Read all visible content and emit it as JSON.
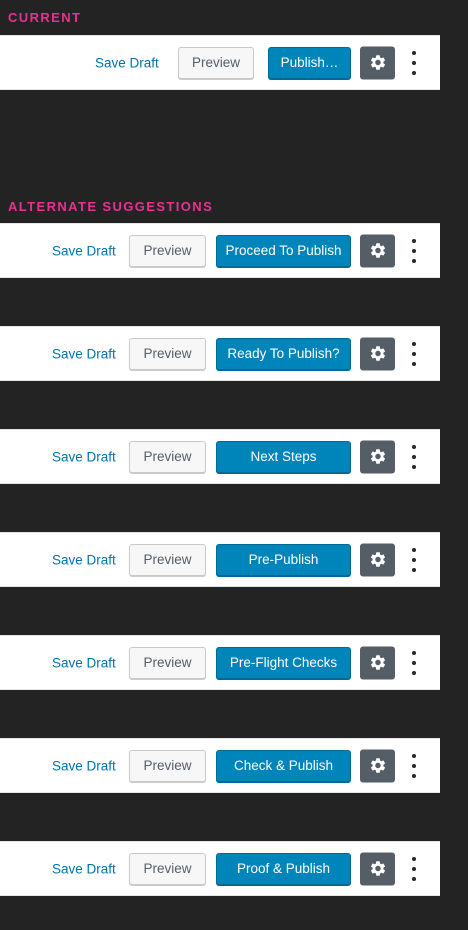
{
  "current": {
    "label": "CURRENT",
    "toolbar": {
      "save_draft": "Save Draft",
      "preview": "Preview",
      "publish": "Publish…"
    }
  },
  "alternates": {
    "label": "ALTERNATE SUGGESTIONS",
    "toolbars": [
      {
        "save_draft": "Save Draft",
        "preview": "Preview",
        "publish": "Proceed To Publish"
      },
      {
        "save_draft": "Save Draft",
        "preview": "Preview",
        "publish": "Ready To Publish?"
      },
      {
        "save_draft": "Save Draft",
        "preview": "Preview",
        "publish": "Next Steps"
      },
      {
        "save_draft": "Save Draft",
        "preview": "Preview",
        "publish": "Pre-Publish"
      },
      {
        "save_draft": "Save Draft",
        "preview": "Preview",
        "publish": "Pre-Flight Checks"
      },
      {
        "save_draft": "Save Draft",
        "preview": "Preview",
        "publish": "Check & Publish"
      },
      {
        "save_draft": "Save Draft",
        "preview": "Preview",
        "publish": "Proof & Publish"
      }
    ]
  },
  "icons": {
    "settings": "gear-icon",
    "more": "more-vertical-icon"
  },
  "colors": {
    "background": "#232323",
    "section_label": "#ec2f95",
    "link": "#0073aa",
    "primary_button": "#0085ba",
    "settings_button": "#555d66"
  }
}
